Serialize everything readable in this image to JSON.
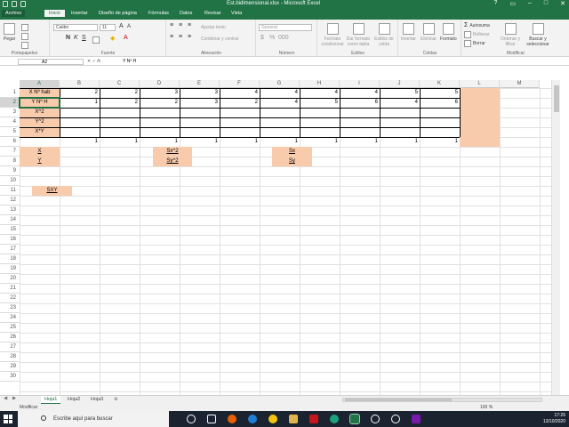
{
  "window": {
    "title_file": "Est.bidimensional.xlsx",
    "title_sep": " - ",
    "title_app": "Microsoft Excel"
  },
  "ribbon": {
    "tabs": [
      "Archivo",
      "Inicio",
      "Insertar",
      "Diseño de página",
      "Fórmulas",
      "Datos",
      "Revisar",
      "Vista"
    ],
    "font_name": "Calibri",
    "font_size": "11",
    "wrap_text": "Ajustar texto",
    "merge_center": "Combinar y centrar",
    "number_format": "General",
    "cond_format": "Formato condicional",
    "format_table": "Dar formato como tabla",
    "cell_styles": "Estilos de celda",
    "insert": "Insertar",
    "delete": "Eliminar",
    "format": "Formato",
    "autosum": "Autosuma",
    "fill": "Rellenar",
    "clear": "Borrar",
    "sort_filter": "Ordenar y filtrar",
    "find_select": "Buscar y seleccionar",
    "paste": "Pegar",
    "groups": {
      "clipboard": "Portapapeles",
      "font": "Fuente",
      "alignment": "Alineación",
      "number": "Número",
      "styles": "Estilos",
      "cells": "Celdas",
      "editing": "Modificar"
    }
  },
  "formula_bar": {
    "name_box": "A2",
    "value": "Y Nº H"
  },
  "sheet": {
    "columns": [
      "A",
      "B",
      "C",
      "D",
      "E",
      "F",
      "G",
      "H",
      "I",
      "J",
      "K",
      "L",
      "M"
    ],
    "rows": [
      "1",
      "2",
      "3",
      "4",
      "5",
      "6",
      "7",
      "8",
      "9",
      "10",
      "11",
      "12",
      "13",
      "14",
      "15",
      "16",
      "17",
      "18",
      "19",
      "20",
      "21",
      "22",
      "23",
      "24",
      "25",
      "26",
      "27",
      "28",
      "29",
      "30"
    ],
    "row1": {
      "label": "X Nº hab",
      "values": [
        "2",
        "2",
        "3",
        "3",
        "4",
        "4",
        "4",
        "4",
        "5",
        "5"
      ]
    },
    "row2": {
      "label": "Y Nº H",
      "values": [
        "1",
        "2",
        "2",
        "3",
        "2",
        "4",
        "5",
        "6",
        "4",
        "6"
      ]
    },
    "row3_label": "X^2",
    "row4_label": "Y^2",
    "row5_label": "X*Y",
    "row6_values": [
      "1",
      "1",
      "1",
      "1",
      "1",
      "1",
      "1",
      "1",
      "1",
      "1"
    ],
    "a7": "X",
    "a8": "Y",
    "a10": "SXY",
    "d7": "Sx^2",
    "d8": "Sy^2",
    "g7": "Sx",
    "g8": "Sy"
  },
  "sheet_tabs": [
    "Hoja1",
    "Hoja2",
    "Hoja3"
  ],
  "status": {
    "mode": "Modificar",
    "zoom": "100 %"
  },
  "taskbar": {
    "search_placeholder": "Escribe aquí para buscar",
    "time": "17:26",
    "date": "13/10/2020"
  },
  "colors": {
    "accent": "#217346",
    "highlight": "#f8cbad"
  }
}
